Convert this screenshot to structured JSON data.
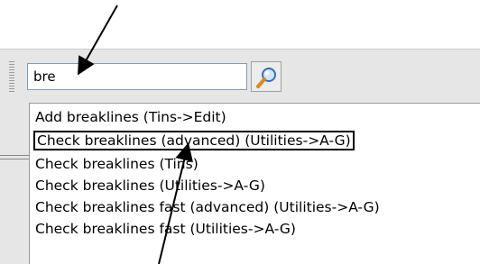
{
  "search": {
    "value": "bre",
    "button_icon": "magnifier-icon"
  },
  "results": [
    "Add breaklines (Tins->Edit)",
    "Check breaklines (advanced) (Utilities->A-G)",
    "Check breaklines (Tins)",
    "Check breaklines (Utilities->A-G)",
    "Check breaklines fast (advanced) (Utilities->A-G)",
    "Check breaklines fast (Utilities->A-G)"
  ],
  "colors": {
    "toolbar_bg": "#e6e6e6",
    "field_border": "#7f9db9",
    "highlight_border": "#000000"
  }
}
